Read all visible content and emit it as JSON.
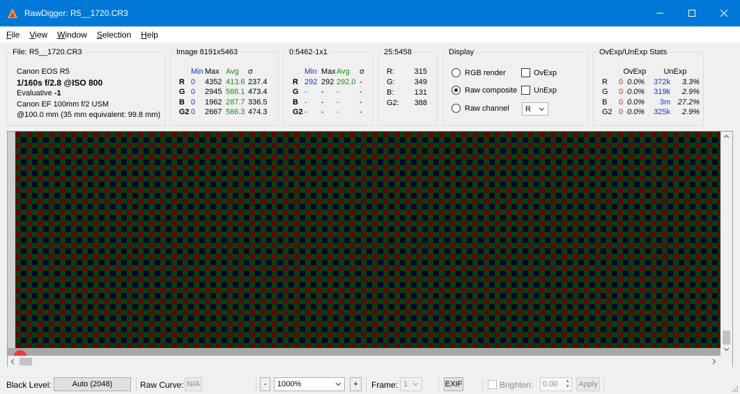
{
  "window": {
    "title": "RawDigger: R5__1720.CR3",
    "accent": "#0078d7"
  },
  "menu": [
    {
      "label": "File",
      "key": "F"
    },
    {
      "label": "View",
      "key": "V"
    },
    {
      "label": "Window",
      "key": "W"
    },
    {
      "label": "Selection",
      "key": "S"
    },
    {
      "label": "Help",
      "key": "H"
    }
  ],
  "file_panel": {
    "title": "File: R5__1720.CR3",
    "camera": "Canon EOS R5",
    "exposure": "1/160s f/2.8 @ISO 800",
    "metering_label": "Evaluative ",
    "metering_value": "-1",
    "lens": "Canon EF 100mm f/2 USM",
    "focal": "@100.0 mm (35 mm equivalent: 99.8 mm)"
  },
  "image_stats": {
    "title": "Image 8191x5463",
    "headers": [
      "Min",
      "Max",
      "Avg",
      "σ"
    ],
    "rows": [
      {
        "ch": "R",
        "min": "0",
        "max": "4352",
        "avg": "413.6",
        "sd": "237.4"
      },
      {
        "ch": "G",
        "min": "0",
        "max": "2945",
        "avg": "586.1",
        "sd": "473.4"
      },
      {
        "ch": "B",
        "min": "0",
        "max": "1962",
        "avg": "287.7",
        "sd": "336.5"
      },
      {
        "ch": "G2",
        "min": "0",
        "max": "2667",
        "avg": "586.3",
        "sd": "474.3"
      }
    ]
  },
  "selection_stats": {
    "title": "0:5462-1x1",
    "headers": [
      "Min",
      "Max",
      "Avg",
      "σ"
    ],
    "rows": [
      {
        "ch": "R",
        "min": "292",
        "max": "292",
        "avg": "292.0",
        "sd": "-"
      },
      {
        "ch": "G",
        "min": "-",
        "max": "-",
        "avg": "-",
        "sd": "-"
      },
      {
        "ch": "B",
        "min": "-",
        "max": "-",
        "avg": "-",
        "sd": "-"
      },
      {
        "ch": "G2",
        "min": "-",
        "max": "-",
        "avg": "-",
        "sd": "-"
      }
    ]
  },
  "point": {
    "title": "25:5458",
    "rows": [
      {
        "k": "R:",
        "v": "315"
      },
      {
        "k": "G:",
        "v": "349"
      },
      {
        "k": "B:",
        "v": "131"
      },
      {
        "k": "G2:",
        "v": "388"
      }
    ]
  },
  "display": {
    "title": "Display",
    "radio_rgb": "RGB render",
    "radio_composite": "Raw composite",
    "radio_channel": "Raw channel",
    "selected": "Raw composite",
    "chk_ovexp": "OvExp",
    "chk_unexp": "UnExp",
    "channel_value": "R"
  },
  "ovexp_stats": {
    "title": "OvExp/UnExp Stats",
    "headers": [
      "OvExp",
      "UnExp"
    ],
    "rows": [
      {
        "ch": "R",
        "ov_n": "0",
        "ov_p": "0.0%",
        "un_n": "372k",
        "un_p": "3.3%"
      },
      {
        "ch": "G",
        "ov_n": "0",
        "ov_p": "0.0%",
        "un_n": "319k",
        "un_p": "2.9%"
      },
      {
        "ch": "B",
        "ov_n": "0",
        "ov_p": "0.0%",
        "un_n": "3m",
        "un_p": "27.2%"
      },
      {
        "ch": "G2",
        "ov_n": "0",
        "ov_p": "0.0%",
        "un_n": "325k",
        "un_p": "2.9%"
      }
    ]
  },
  "viewer": {
    "bayer_colors": {
      "red": "#5a0a0c",
      "green": "#07400b",
      "blue": "#07072e",
      "green2": "#0a3d0d"
    }
  },
  "statusbar": {
    "black_level_label": "Black Level:",
    "black_level_value": "Auto (2048)",
    "raw_curve_label": "Raw Curve:",
    "raw_curve_value": "N/A",
    "zoom_minus": "-",
    "zoom_value": "1000%",
    "zoom_plus": "+",
    "frame_label": "Frame:",
    "frame_value": "1",
    "exif": "EXIF",
    "brighten_label": "Brighten:",
    "brighten_value": "0.00",
    "apply": "Apply"
  }
}
